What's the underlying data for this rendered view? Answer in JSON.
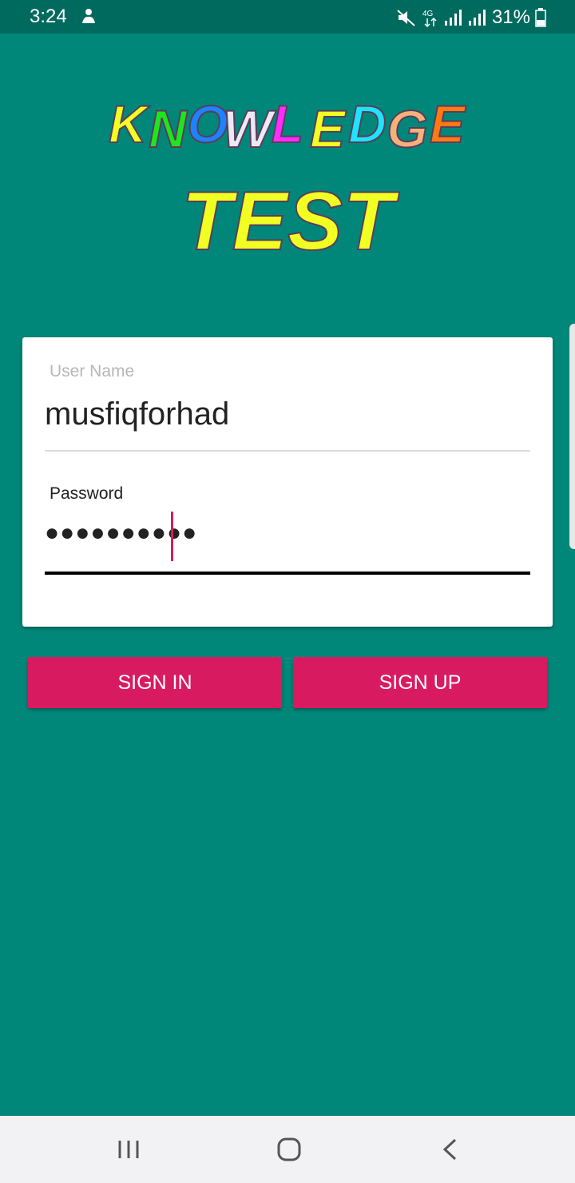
{
  "status_bar": {
    "time": "3:24",
    "network": "4G",
    "battery": "31%"
  },
  "logo": {
    "line1": "KNOWLEDGE",
    "line2": "TEST",
    "letter_colors": [
      "#f2ff22",
      "#1ee51e",
      "#1e82ff",
      "#ece9f4",
      "#ff2bff",
      "#f2ff22",
      "#1ee3ff",
      "#f4b27a",
      "#ff7a14",
      "#ff2fb4",
      "#9ecf9a"
    ],
    "test_color": "#f2ff22"
  },
  "login": {
    "username_label": "User Name",
    "username_value": "musfiqforhad",
    "password_label": "Password",
    "password_value": "●●●●●●●●●●"
  },
  "buttons": {
    "sign_in": "SIGN IN",
    "sign_up": "SIGN UP"
  },
  "colors": {
    "background": "#00877a",
    "status_bar": "#006a5f",
    "accent": "#d81b60"
  }
}
